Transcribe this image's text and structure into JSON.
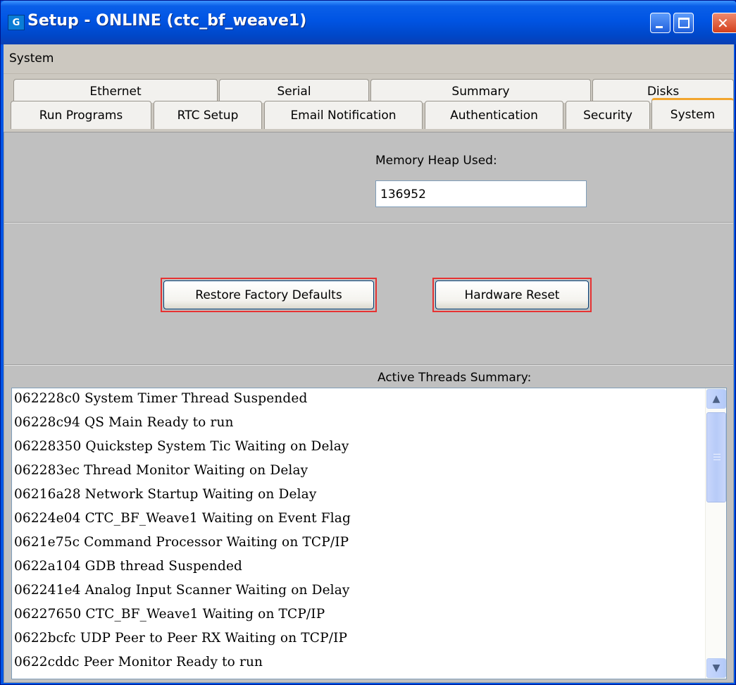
{
  "window": {
    "title": "Setup - ONLINE (ctc_bf_weave1)",
    "app_icon_glyph": "G"
  },
  "menubar": {
    "items": [
      {
        "label": "System"
      }
    ]
  },
  "tabs": {
    "row1": [
      {
        "label": "Ethernet"
      },
      {
        "label": "Serial"
      },
      {
        "label": "Summary"
      },
      {
        "label": "Disks"
      }
    ],
    "row2": [
      {
        "label": "Run Programs"
      },
      {
        "label": "RTC Setup"
      },
      {
        "label": "Email Notification"
      },
      {
        "label": "Authentication"
      },
      {
        "label": "Security"
      },
      {
        "label": "System"
      }
    ],
    "active": "System"
  },
  "memory": {
    "label": "Memory Heap Used:",
    "value": "136952"
  },
  "buttons": {
    "restore_label": "Restore Factory Defaults",
    "reset_label": "Hardware Reset"
  },
  "threads": {
    "label": "Active Threads Summary:",
    "lines": [
      "062228c0 System Timer Thread Suspended",
      "06228c94 QS Main Ready to run",
      "06228350 Quickstep System Tic Waiting on Delay",
      "062283ec Thread Monitor Waiting on Delay",
      "06216a28 Network Startup Waiting on Delay",
      "06224e04 CTC_BF_Weave1 Waiting on Event Flag",
      "0621e75c Command Processor Waiting on TCP/IP",
      "0622a104 GDB thread Suspended",
      "062241e4 Analog Input Scanner Waiting on Delay",
      "06227650 CTC_BF_Weave1 Waiting on TCP/IP",
      "0622bcfc UDP Peer to Peer RX Waiting on TCP/IP",
      "0622cddc Peer Monitor Ready to run"
    ]
  },
  "icons": {
    "scroll_up": "▲",
    "scroll_down": "▼",
    "close": "✕"
  },
  "colors": {
    "titlebar": "#0054e3",
    "active_tab_accent": "#f2a52d",
    "button_outline": "#e63232",
    "panel": "#c0c0c0"
  }
}
